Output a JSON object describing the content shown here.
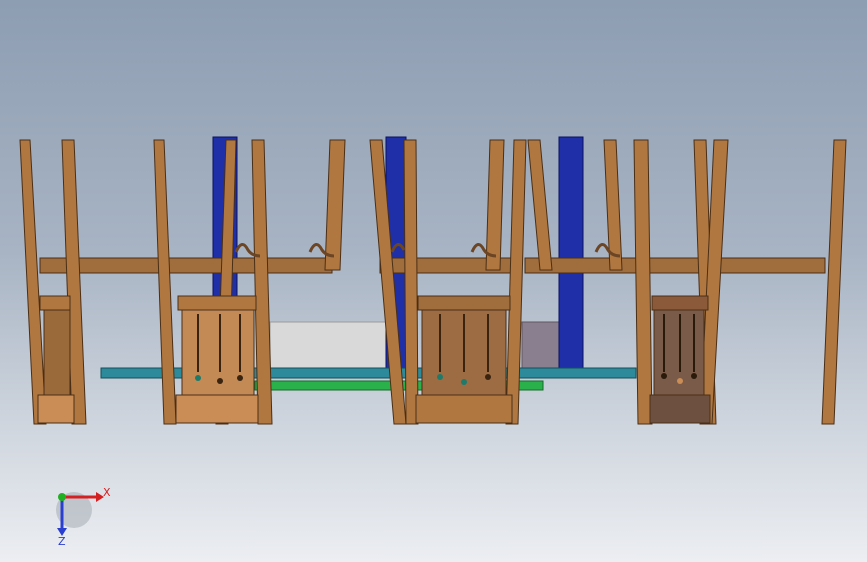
{
  "viewport": {
    "background_top": "#8d9db2",
    "background_bottom": "#eceef2"
  },
  "model": {
    "wood_color": "#b07840",
    "wood_dark": "#6b4524",
    "wood_light": "#c98d55",
    "shade_color": "#7a5a48",
    "blue_post_color": "#1f2fa8",
    "cyan_bar_color": "#2c8a9a",
    "green_bar_color": "#2bb14c",
    "grey_panel_color": "#d9d9d9",
    "mauve_panel_color": "#8a7f8e"
  },
  "triad": {
    "x_label": "X",
    "z_label": "Z",
    "x_color": "#d42020",
    "y_color": "#22b022",
    "z_color": "#2a3fd0"
  }
}
